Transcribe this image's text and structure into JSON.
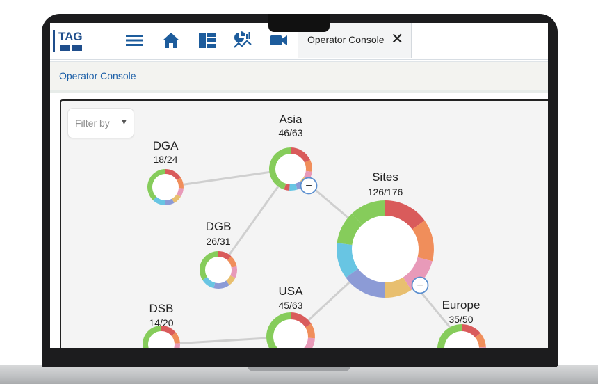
{
  "header": {
    "logo_text": "TAG",
    "tab_label": "Operator Console",
    "close_symbol": "✕",
    "nav_icons": [
      "menu-icon",
      "home-icon",
      "dashboard-icon",
      "analytics-icon",
      "video-camera-icon"
    ]
  },
  "breadcrumb": "Operator Console",
  "filter": {
    "placeholder": "Filter by",
    "caret": "▼"
  },
  "graph": {
    "nodes": [
      {
        "id": "sites",
        "name": "Sites",
        "count": "126/176"
      },
      {
        "id": "asia",
        "name": "Asia",
        "count": "46/63"
      },
      {
        "id": "dga",
        "name": "DGA",
        "count": "18/24"
      },
      {
        "id": "dgb",
        "name": "DGB",
        "count": "26/31"
      },
      {
        "id": "usa",
        "name": "USA",
        "count": "45/63"
      },
      {
        "id": "dsb",
        "name": "DSB",
        "count": "14/20"
      },
      {
        "id": "europe",
        "name": "Europe",
        "count": "35/50"
      }
    ],
    "collapse_symbol": "−",
    "segment_colors": [
      "#86cc5b",
      "#d95b5b",
      "#f08e5b",
      "#e89ab9",
      "#e8bf6f",
      "#8c9bd6",
      "#68c5e3"
    ]
  }
}
